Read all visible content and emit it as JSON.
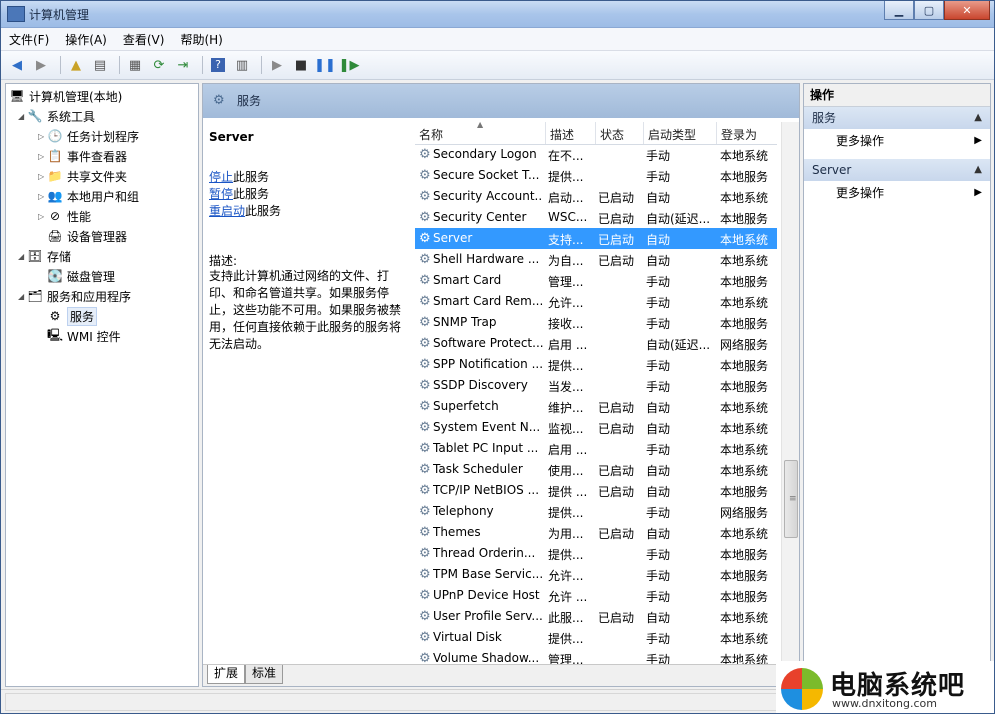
{
  "window": {
    "title": "计算机管理"
  },
  "menu": [
    "文件(F)",
    "操作(A)",
    "查看(V)",
    "帮助(H)"
  ],
  "tree": {
    "root": "计算机管理(本地)",
    "system_tools": "系统工具",
    "task_scheduler": "任务计划程序",
    "event_viewer": "事件查看器",
    "shared_folders": "共享文件夹",
    "local_users": "本地用户和组",
    "performance": "性能",
    "device_manager": "设备管理器",
    "storage": "存储",
    "disk_management": "磁盘管理",
    "services_apps": "服务和应用程序",
    "services": "服务",
    "wmi": "WMI 控件"
  },
  "center": {
    "header": "服务",
    "selected_name": "Server",
    "links": [
      {
        "link": "停止",
        "rest": "此服务"
      },
      {
        "link": "暂停",
        "rest": "此服务"
      },
      {
        "link": "重启动",
        "rest": "此服务"
      }
    ],
    "desc_label": "描述:",
    "desc_text": "支持此计算机通过网络的文件、打印、和命名管道共享。如果服务停止，这些功能不可用。如果服务被禁用，任何直接依赖于此服务的服务将无法启动。",
    "columns": {
      "name": "名称",
      "desc": "描述",
      "status": "状态",
      "startup": "启动类型",
      "logon": "登录为"
    },
    "rows": [
      {
        "name": "Secondary Logon",
        "desc": "在不...",
        "status": "",
        "startup": "手动",
        "logon": "本地系统"
      },
      {
        "name": "Secure Socket T...",
        "desc": "提供...",
        "status": "",
        "startup": "手动",
        "logon": "本地服务"
      },
      {
        "name": "Security Account...",
        "desc": "启动...",
        "status": "已启动",
        "startup": "自动",
        "logon": "本地系统"
      },
      {
        "name": "Security Center",
        "desc": "WSC...",
        "status": "已启动",
        "startup": "自动(延迟...",
        "logon": "本地服务"
      },
      {
        "name": "Server",
        "desc": "支持...",
        "status": "已启动",
        "startup": "自动",
        "logon": "本地系统"
      },
      {
        "name": "Shell Hardware ...",
        "desc": "为自...",
        "status": "已启动",
        "startup": "自动",
        "logon": "本地系统"
      },
      {
        "name": "Smart Card",
        "desc": "管理...",
        "status": "",
        "startup": "手动",
        "logon": "本地服务"
      },
      {
        "name": "Smart Card Rem...",
        "desc": "允许...",
        "status": "",
        "startup": "手动",
        "logon": "本地系统"
      },
      {
        "name": "SNMP Trap",
        "desc": "接收...",
        "status": "",
        "startup": "手动",
        "logon": "本地服务"
      },
      {
        "name": "Software Protect...",
        "desc": "启用 ...",
        "status": "",
        "startup": "自动(延迟...",
        "logon": "网络服务"
      },
      {
        "name": "SPP Notification ...",
        "desc": "提供...",
        "status": "",
        "startup": "手动",
        "logon": "本地服务"
      },
      {
        "name": "SSDP Discovery",
        "desc": "当发...",
        "status": "",
        "startup": "手动",
        "logon": "本地服务"
      },
      {
        "name": "Superfetch",
        "desc": "维护...",
        "status": "已启动",
        "startup": "自动",
        "logon": "本地系统"
      },
      {
        "name": "System Event N...",
        "desc": "监视...",
        "status": "已启动",
        "startup": "自动",
        "logon": "本地系统"
      },
      {
        "name": "Tablet PC Input ...",
        "desc": "启用 ...",
        "status": "",
        "startup": "手动",
        "logon": "本地系统"
      },
      {
        "name": "Task Scheduler",
        "desc": "使用...",
        "status": "已启动",
        "startup": "自动",
        "logon": "本地系统"
      },
      {
        "name": "TCP/IP NetBIOS ...",
        "desc": "提供 ...",
        "status": "已启动",
        "startup": "自动",
        "logon": "本地服务"
      },
      {
        "name": "Telephony",
        "desc": "提供...",
        "status": "",
        "startup": "手动",
        "logon": "网络服务"
      },
      {
        "name": "Themes",
        "desc": "为用...",
        "status": "已启动",
        "startup": "自动",
        "logon": "本地系统"
      },
      {
        "name": "Thread Orderin...",
        "desc": "提供...",
        "status": "",
        "startup": "手动",
        "logon": "本地服务"
      },
      {
        "name": "TPM Base Servic...",
        "desc": "允许...",
        "status": "",
        "startup": "手动",
        "logon": "本地服务"
      },
      {
        "name": "UPnP Device Host",
        "desc": "允许 ...",
        "status": "",
        "startup": "手动",
        "logon": "本地服务"
      },
      {
        "name": "User Profile Serv...",
        "desc": "此服...",
        "status": "已启动",
        "startup": "自动",
        "logon": "本地系统"
      },
      {
        "name": "Virtual Disk",
        "desc": "提供...",
        "status": "",
        "startup": "手动",
        "logon": "本地系统"
      },
      {
        "name": "Volume Shadow...",
        "desc": "管理...",
        "status": "",
        "startup": "手动",
        "logon": "本地系统"
      }
    ],
    "tabs": [
      "扩展",
      "标准"
    ]
  },
  "actions": {
    "title": "操作",
    "sections": [
      {
        "title": "服务",
        "item": "更多操作"
      },
      {
        "title": "Server",
        "item": "更多操作"
      }
    ]
  },
  "watermark": {
    "title": "电脑系统吧",
    "url": "www.dnxitong.com"
  },
  "colors": {
    "selection": "#3399ff",
    "header_blue": "#a9c1df",
    "link": "#1a55c5"
  }
}
